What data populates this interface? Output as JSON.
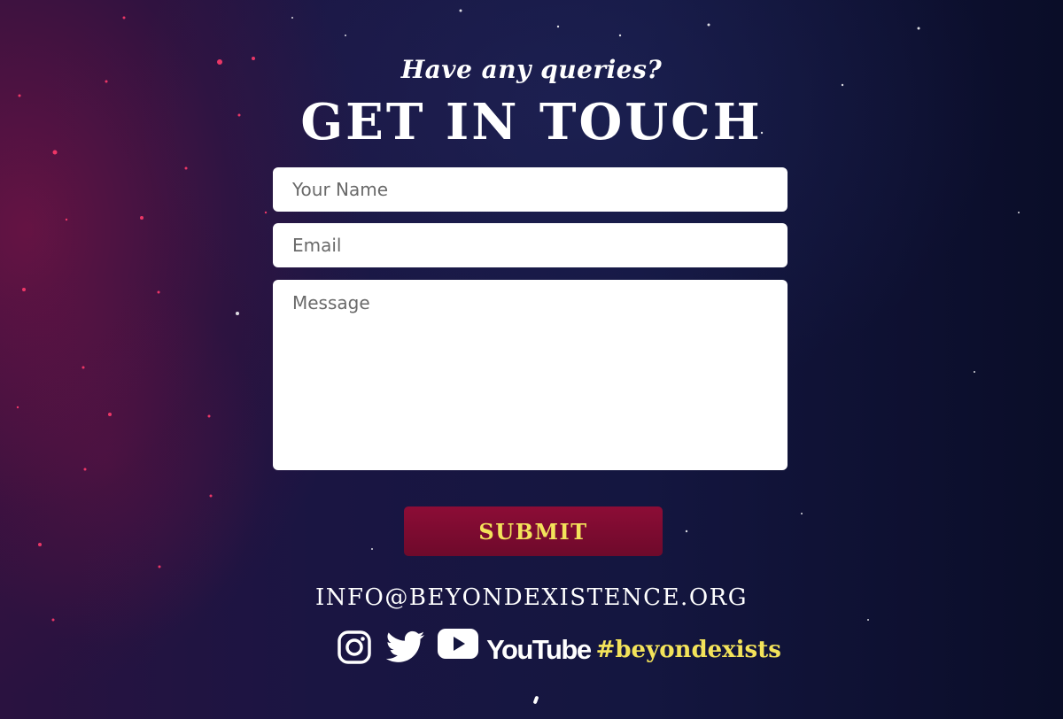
{
  "header": {
    "eyebrow": "Have any queries?",
    "title": "GET IN TOUCH"
  },
  "form": {
    "name_placeholder": "Your Name",
    "email_placeholder": "Email",
    "message_placeholder": "Message",
    "submit_label": "SUBMIT"
  },
  "contact": {
    "email": "INFO@BEYONDEXISTENCE.ORG"
  },
  "social": {
    "icons": [
      "instagram-icon",
      "twitter-icon",
      "youtube-icon"
    ],
    "youtube_wordmark": "YouTube",
    "hashtag": "#beyondexists"
  },
  "colors": {
    "accent_yellow": "#f3e35a",
    "button_crimson": "#7d0b30",
    "background_navy": "#141640",
    "nebula_magenta": "#96144a"
  }
}
